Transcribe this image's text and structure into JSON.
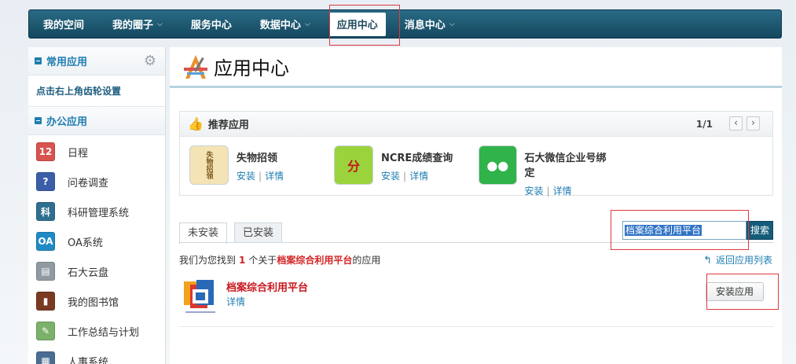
{
  "nav": {
    "items": [
      {
        "label": "我的空间",
        "dropdown": false,
        "active": false
      },
      {
        "label": "我的圈子",
        "dropdown": true,
        "active": false
      },
      {
        "label": "服务中心",
        "dropdown": false,
        "active": false
      },
      {
        "label": "数据中心",
        "dropdown": true,
        "active": false
      },
      {
        "label": "应用中心",
        "dropdown": false,
        "active": true
      },
      {
        "label": "消息中心",
        "dropdown": true,
        "active": false
      }
    ],
    "chevron": "⌵"
  },
  "sidebar": {
    "common_title": "常用应用",
    "hint": "点击右上角齿轮设置",
    "office_title": "办公应用",
    "items": [
      {
        "label": "日程",
        "icon": "calendar-icon",
        "glyph": "12",
        "color": "#d9534f"
      },
      {
        "label": "问卷调查",
        "icon": "survey-icon",
        "glyph": "?",
        "color": "#3a5fa8"
      },
      {
        "label": "科研管理系统",
        "icon": "research-icon",
        "glyph": "科",
        "color": "#2f6f8f"
      },
      {
        "label": "OA系统",
        "icon": "oa-icon",
        "glyph": "OA",
        "color": "#1f8ac4"
      },
      {
        "label": "石大云盘",
        "icon": "cloud-disk-icon",
        "glyph": "▤",
        "color": "#8f9aa1"
      },
      {
        "label": "我的图书馆",
        "icon": "library-icon",
        "glyph": "▮",
        "color": "#7a3b22"
      },
      {
        "label": "工作总结与计划",
        "icon": "notebook-icon",
        "glyph": "✎",
        "color": "#7bb16a"
      },
      {
        "label": "人事系统",
        "icon": "hr-icon",
        "glyph": "▦",
        "color": "#4a6e91"
      }
    ]
  },
  "page": {
    "title": "应用中心"
  },
  "recommend": {
    "title": "推荐应用",
    "pager": "1/1",
    "apps": [
      {
        "name": "失物招领",
        "install": "安装",
        "detail": "详情",
        "glyph": "失物招领",
        "bg": "#f4e3b5",
        "fg": "#7a5a1e"
      },
      {
        "name": "NCRE成绩查询",
        "install": "安装",
        "detail": "详情",
        "glyph": "分",
        "bg": "#9bd33c",
        "fg": "#c8161d"
      },
      {
        "name": "石大微信企业号绑定",
        "install": "安装",
        "detail": "详情",
        "glyph": "●●",
        "bg": "#2fb34a",
        "fg": "#ffffff"
      }
    ]
  },
  "tabs": {
    "not_installed": "未安装",
    "installed": "已安装"
  },
  "search": {
    "value": "档案综合利用平台",
    "button": "搜索"
  },
  "result": {
    "prefix": "我们为您找到",
    "count": "1",
    "middle": "个关于",
    "keyword": "档案综合利用平台",
    "suffix": "的应用",
    "back": "返回应用列表",
    "app_name": "档案综合利用平台",
    "detail": "详情",
    "install": "安装应用"
  }
}
